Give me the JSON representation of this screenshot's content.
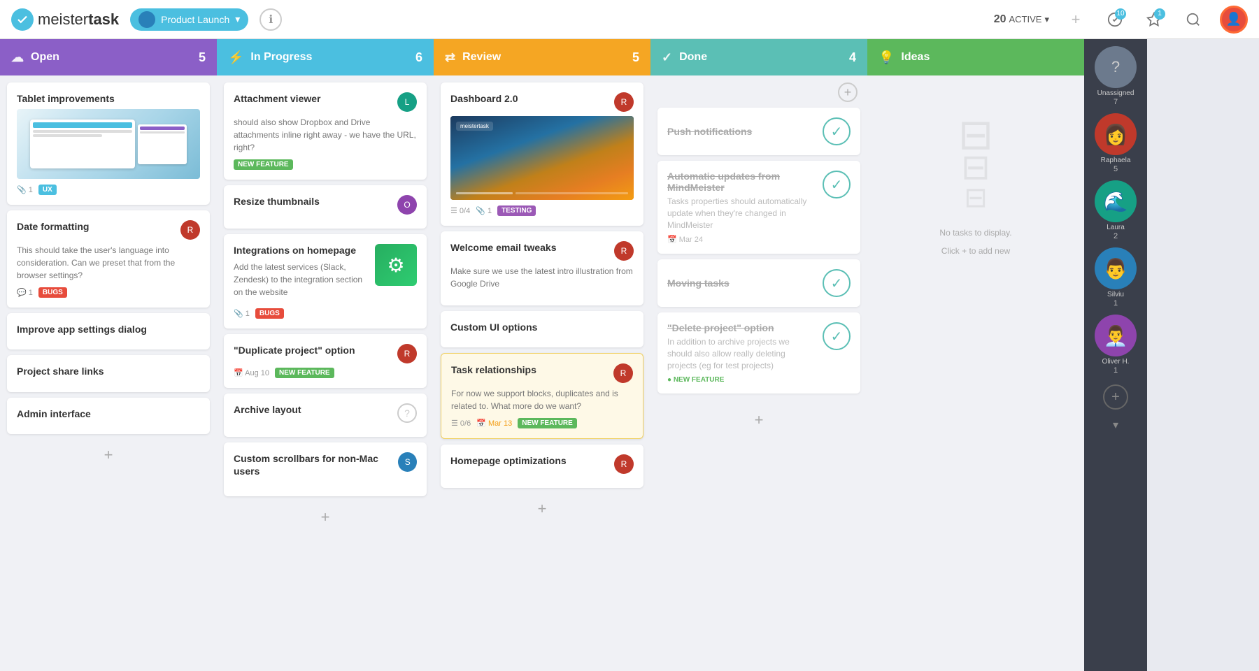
{
  "app": {
    "logo_name": "meister",
    "logo_bold": "task",
    "project": "Product Launch",
    "nav": {
      "active_label": "ACTIVE",
      "active_count": "20",
      "checkmark_count": "10",
      "star_count": "1"
    }
  },
  "columns": {
    "open": {
      "label": "Open",
      "count": "5",
      "icon": "☁"
    },
    "inprogress": {
      "label": "In Progress",
      "count": "6",
      "icon": "⚡"
    },
    "review": {
      "label": "Review",
      "count": "5",
      "icon": "⇄"
    },
    "done": {
      "label": "Done",
      "count": "4",
      "icon": "✓"
    },
    "ideas": {
      "label": "Ideas",
      "count": "",
      "icon": "💡"
    }
  },
  "open_cards": [
    {
      "title": "Tablet improvements",
      "has_image": true,
      "meta": {
        "attachments": "1",
        "tag": "UX",
        "tag_class": "tag-ux"
      }
    },
    {
      "title": "Date formatting",
      "desc": "This should take the user's language into consideration. Can we preset that from the browser settings?",
      "meta": {
        "comments": "1",
        "tag": "BUGS",
        "tag_class": "tag-bugs"
      },
      "has_avatar": true
    },
    {
      "title": "Improve app settings dialog"
    },
    {
      "title": "Project share links"
    },
    {
      "title": "Admin interface"
    }
  ],
  "inprogress_cards": [
    {
      "title": "Attachment viewer",
      "desc": "should also show Dropbox and Drive attachments inline right away - we have the URL, right?",
      "meta": {
        "tag": "NEW FEATURE",
        "tag_class": "tag-feature"
      },
      "has_avatar": true
    },
    {
      "title": "Resize thumbnails",
      "has_avatar": true
    },
    {
      "title": "Integrations on homepage",
      "desc": "Add the latest services (Slack, Zendesk) to the integration section on the website",
      "meta": {
        "attachments": "1",
        "tag": "BUGS",
        "tag_class": "tag-bugs"
      },
      "has_image_small": true
    },
    {
      "title": "\"Duplicate project\" option",
      "meta": {
        "date": "Aug 10",
        "tag": "NEW FEATURE",
        "tag_class": "tag-feature"
      },
      "has_avatar": true
    },
    {
      "title": "Archive layout",
      "meta": {
        "help": true
      }
    },
    {
      "title": "Custom scrollbars for non-Mac users",
      "has_avatar": true
    }
  ],
  "review_cards": [
    {
      "title": "Dashboard 2.0",
      "has_dashboard_image": true,
      "meta": {
        "checklist": "0/4",
        "attachments": "1",
        "tag": "TESTING",
        "tag_class": "tag-testing"
      },
      "has_avatar": true
    },
    {
      "title": "Welcome email tweaks",
      "desc": "Make sure we use the latest intro illustration from Google Drive",
      "has_avatar": true
    },
    {
      "title": "Custom UI options"
    },
    {
      "title": "Task relationships",
      "desc": "For now we support blocks, duplicates and is related to. What more do we want?",
      "meta": {
        "checklist": "0/6",
        "date": "Mar 13",
        "tag": "NEW FEATURE",
        "tag_class": "tag-feature"
      },
      "has_avatar": true,
      "highlighted": true
    },
    {
      "title": "Homepage optimizations",
      "has_avatar": true
    }
  ],
  "done_cards": [
    {
      "title": "Push notifications",
      "is_done": true
    },
    {
      "title": "Automatic updates from MindMeister",
      "desc": "Tasks properties should automatically update when they're changed in MindMeister",
      "meta": {
        "date": "Mar 24"
      },
      "is_done": true
    },
    {
      "title": "Moving tasks",
      "is_done": true
    },
    {
      "title": "\"Delete project\" option",
      "desc": "In addition to archive projects we should also allow really deleting projects (eg for test projects)",
      "meta": {
        "tag": "NEW FEATURE",
        "tag_class": "tag-feature"
      },
      "is_done": true
    }
  ],
  "ideas_sidebar": {
    "no_tasks_text": "No tasks to display.",
    "click_add_text": "Click + to add new"
  },
  "sidebar_users": [
    {
      "name": "Unassigned",
      "count": "7",
      "class": "sa-unassigned",
      "initial": "?"
    },
    {
      "name": "Raphaela",
      "count": "5",
      "class": "sa-raphaela",
      "initial": "R"
    },
    {
      "name": "Laura",
      "count": "2",
      "class": "sa-laura",
      "initial": "L"
    },
    {
      "name": "Silviu",
      "count": "1",
      "class": "sa-silviu",
      "initial": "S"
    },
    {
      "name": "Oliver H.",
      "count": "1",
      "class": "sa-oliver",
      "initial": "O"
    }
  ]
}
